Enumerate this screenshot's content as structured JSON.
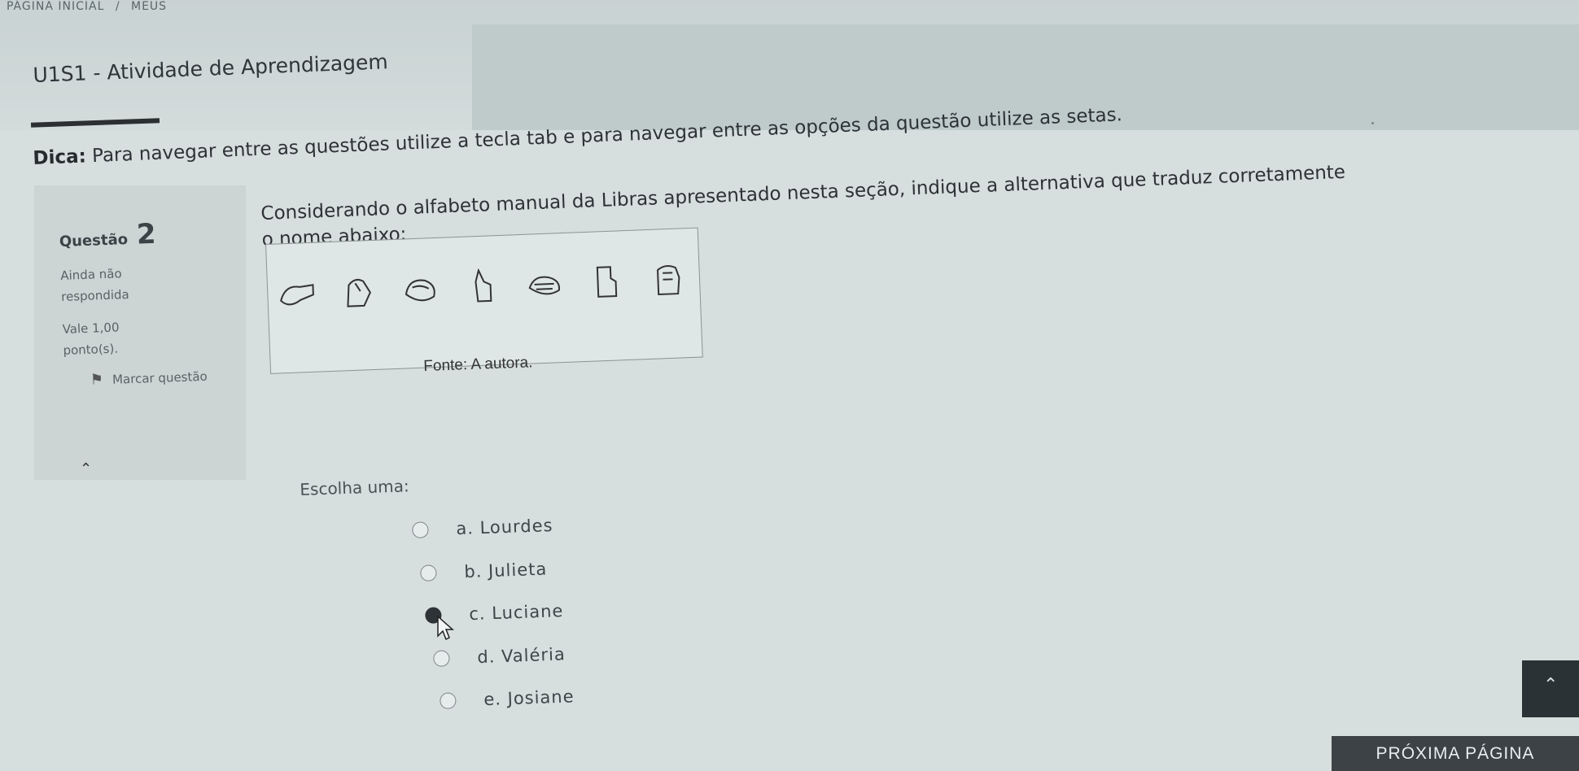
{
  "breadcrumb": {
    "home": "PÁGINA INICIAL",
    "separator": "/",
    "next": "MEUS"
  },
  "course": {
    "title": "U1S1 - Atividade de Aprendizagem"
  },
  "tip": {
    "label": "Dica:",
    "text_part1": "Para navegar entre as questões utilize a tecla tab e para navegar entre as opções da questão utilize as setas."
  },
  "question": {
    "label": "Questão",
    "number": "2",
    "status": "Ainda não respondida",
    "points": "Vale 1,00 ponto(s).",
    "flag_label": "Marcar questão",
    "text_line1": "Considerando o alfabeto manual da Libras apresentado nesta seção, indique a alternativa que traduz corretamente",
    "text_line2": "o nome abaixo:",
    "image_caption": "Fonte: A autora.",
    "choose_label": "Escolha uma:",
    "options": [
      {
        "label": "a. Lourdes",
        "checked": false
      },
      {
        "label": "b. Julieta",
        "checked": false
      },
      {
        "label": "c. Luciane",
        "checked": true
      },
      {
        "label": "d. Valéria",
        "checked": false
      },
      {
        "label": "e. Josiane",
        "checked": false
      }
    ]
  },
  "next_button": "PRÓXIMA PÁGINA",
  "icons": {
    "flag": "flag-icon",
    "scroll_top": "chevron-up-icon",
    "cursor": "mouse-pointer-icon"
  }
}
